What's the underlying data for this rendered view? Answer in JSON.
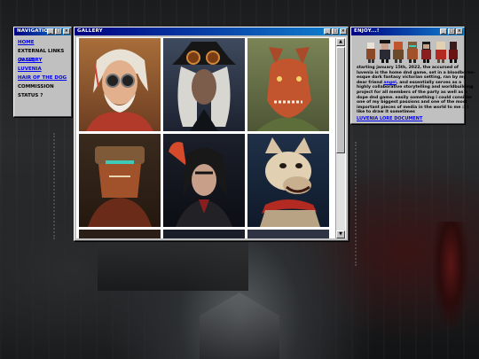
{
  "navigation": {
    "title": "NAVIGATION",
    "items": [
      {
        "label": "HOME"
      },
      {
        "label": "EXTERNAL LINKS",
        "extra": "(N.SZ)"
      },
      {
        "label": "GALLERY"
      },
      {
        "label": "LUVENIA"
      },
      {
        "label": "HAIR OF THE DOG"
      },
      {
        "label": "COMMISSION STATUS ?"
      }
    ]
  },
  "gallery": {
    "title": "GALLERY"
  },
  "enjoy": {
    "title": "ENJOY...!",
    "text_1": "starting january 15th, 2022, the accursed of luvenia is the home dnd game, set in a bloodborne-esque dark fantasy victorian setting, ran by my dear friend",
    "friend_link": "angel",
    "text_2": ", and essentially serves as a highly collaborative storytelling and worldbuilding project for all members of the party as well as a dope dnd game. easily something i could consider one of my biggest passions and one of the most important pieces of media in the world to me :) i like to draw it sometimes",
    "lore_link": "LUVENIA LORE DOCUMENT"
  },
  "window_buttons": {
    "minimize": "_",
    "maximize": "□",
    "close": "×"
  },
  "colors": {
    "titlebar_start": "#000080",
    "titlebar_end": "#1084d0",
    "window_face": "#c0c0c0",
    "link": "#0000ee"
  }
}
